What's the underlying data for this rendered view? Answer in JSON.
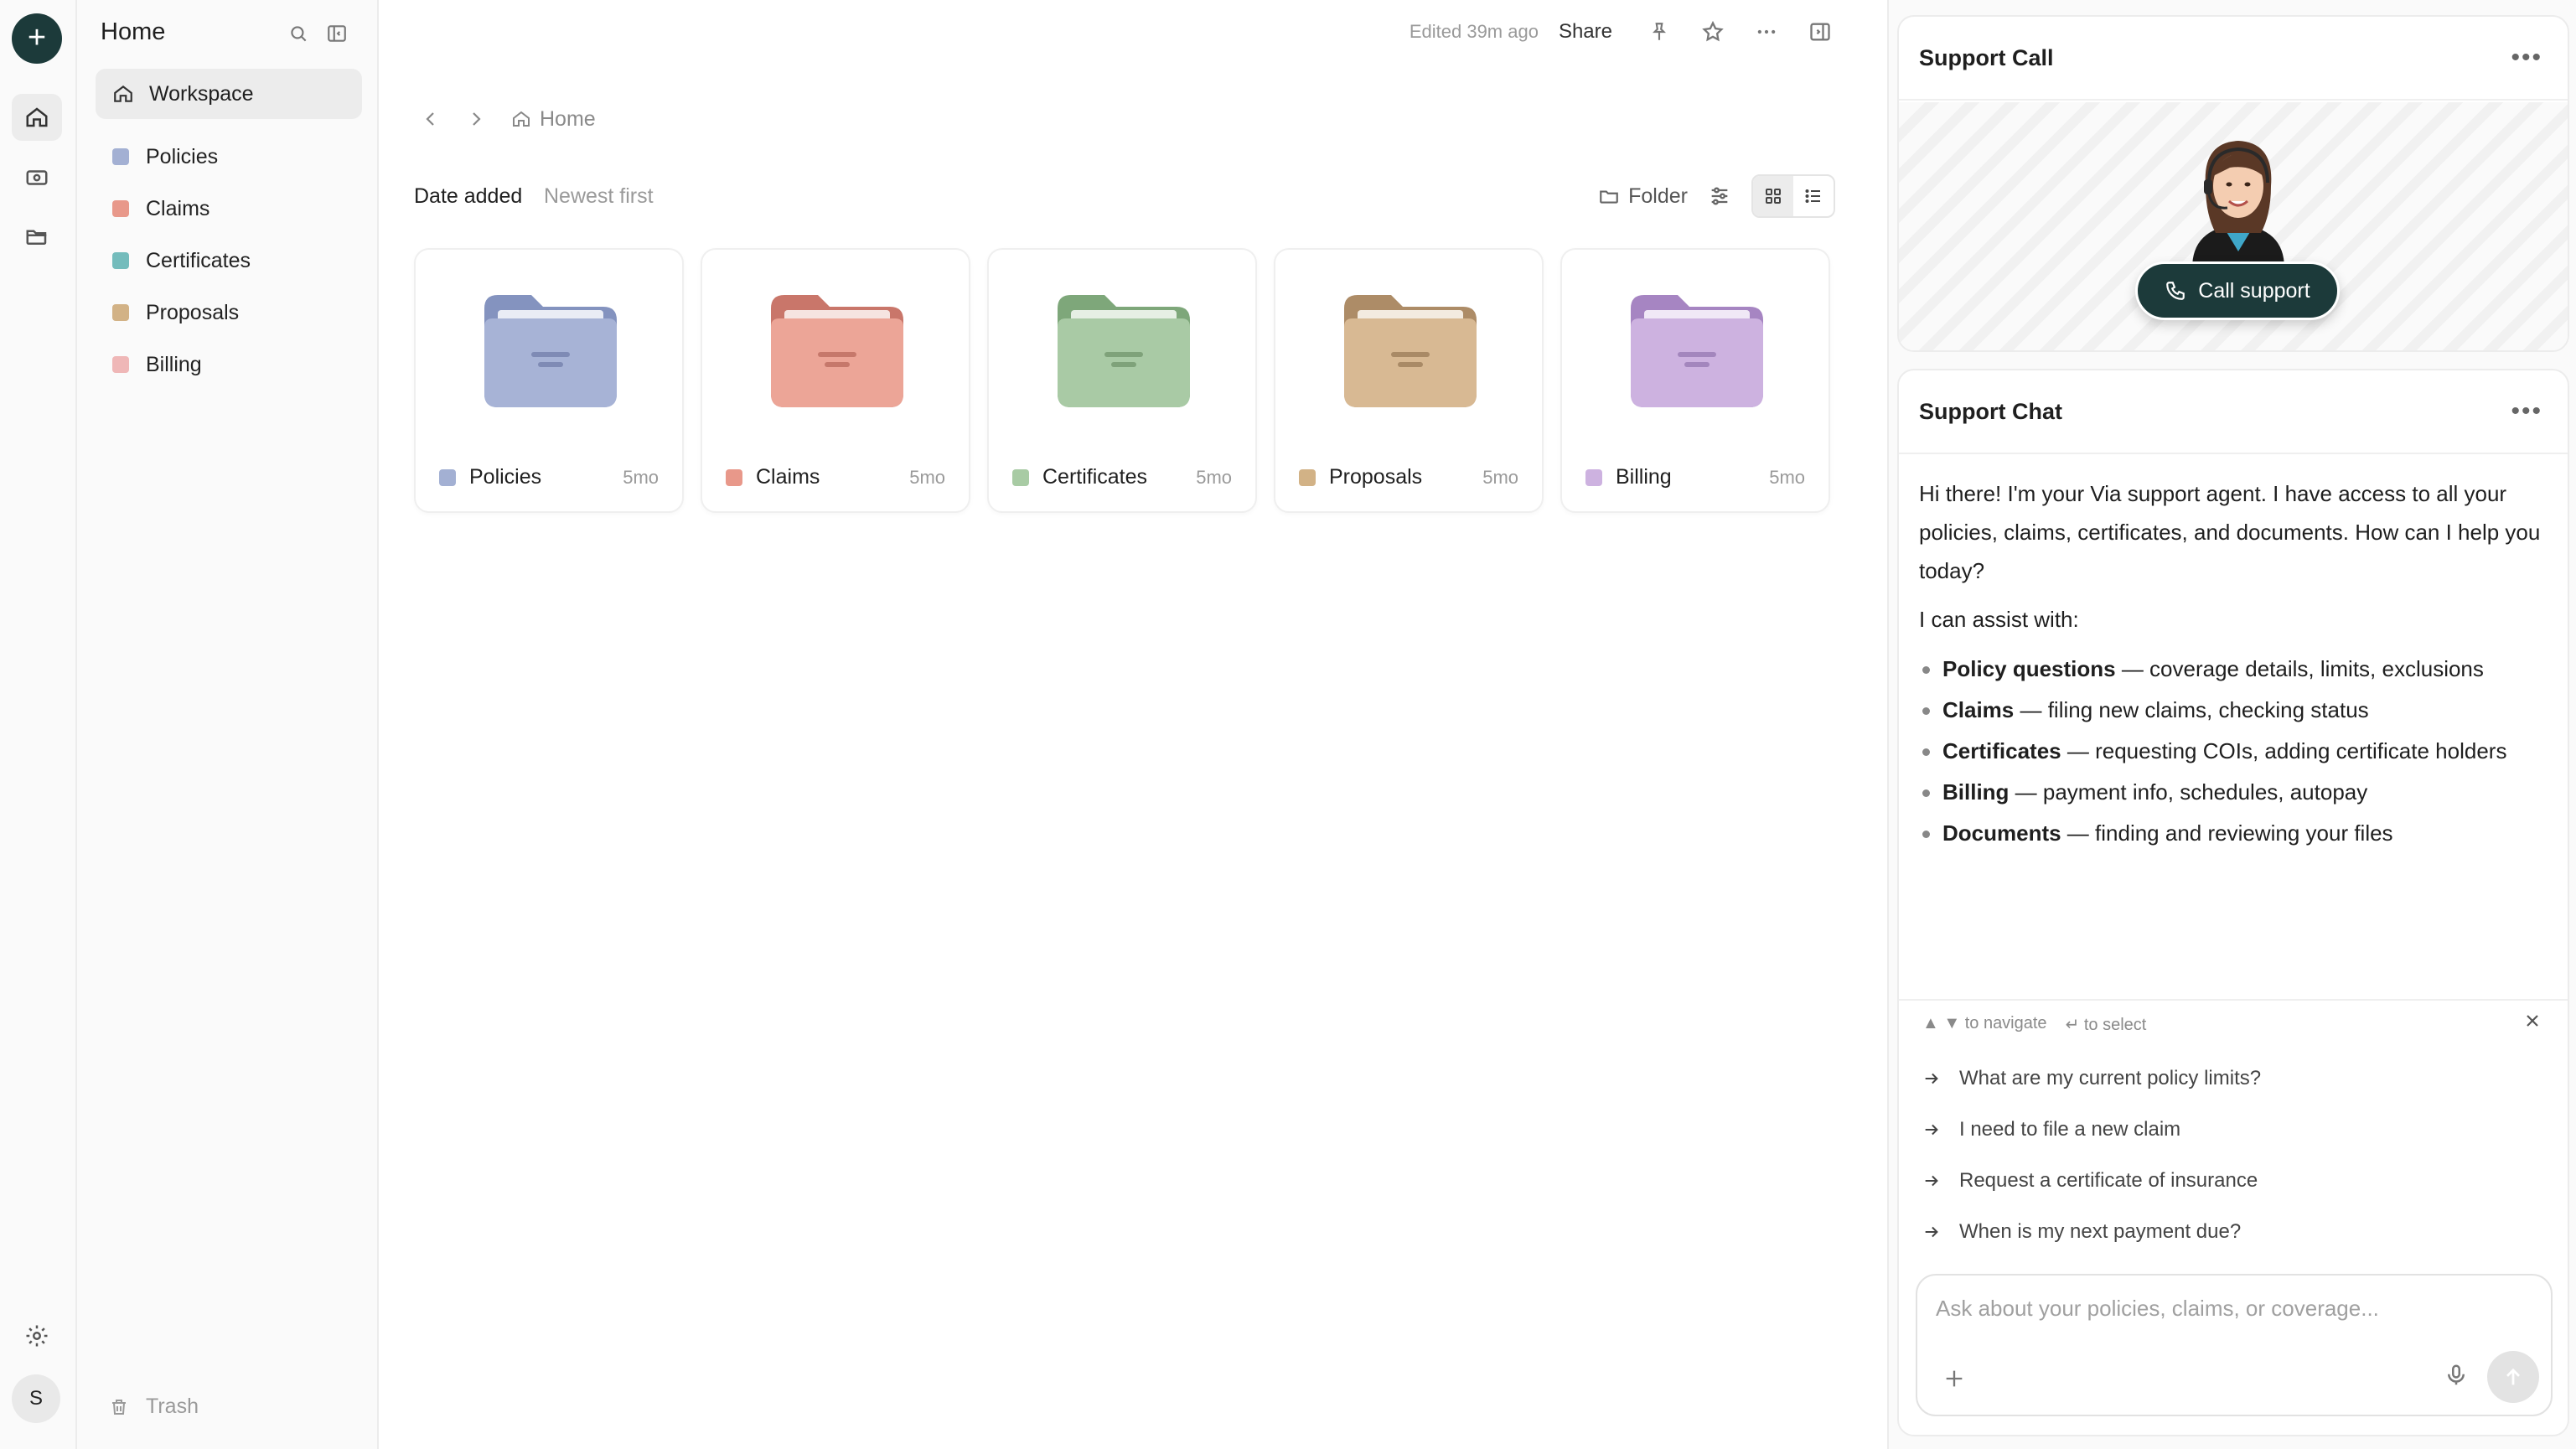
{
  "rail": {
    "new_label": "+",
    "user_initial": "S"
  },
  "sidebar": {
    "title": "Home",
    "workspace_label": "Workspace",
    "items": [
      {
        "label": "Policies",
        "color": "#a3b0d3"
      },
      {
        "label": "Claims",
        "color": "#e8988a"
      },
      {
        "label": "Certificates",
        "color": "#74bcbc"
      },
      {
        "label": "Proposals",
        "color": "#d2b286"
      },
      {
        "label": "Billing",
        "color": "#efb7b7"
      }
    ],
    "trash_label": "Trash"
  },
  "topbar": {
    "edited": "Edited 39m ago",
    "share": "Share"
  },
  "breadcrumb": {
    "home": "Home"
  },
  "toolbar": {
    "sort_label": "Date added",
    "sort_value": "Newest first",
    "folder_label": "Folder"
  },
  "folders": [
    {
      "name": "Policies",
      "age": "5mo",
      "color": "#a7b3d6",
      "dark": "#8493bf",
      "swatch": "#a3b0d3"
    },
    {
      "name": "Claims",
      "age": "5mo",
      "color": "#eca597",
      "dark": "#c9766a",
      "swatch": "#e8988a"
    },
    {
      "name": "Certificates",
      "age": "5mo",
      "color": "#a9caa5",
      "dark": "#7ea77a",
      "swatch": "#a8cba4"
    },
    {
      "name": "Proposals",
      "age": "5mo",
      "color": "#d8b993",
      "dark": "#ad8c67",
      "swatch": "#d2b286"
    },
    {
      "name": "Billing",
      "age": "5mo",
      "color": "#cdb2e0",
      "dark": "#a685c2",
      "swatch": "#cdb2e0"
    }
  ],
  "support_call": {
    "title": "Support Call",
    "button": "Call support"
  },
  "support_chat": {
    "title": "Support Chat",
    "intro": "Hi there! I'm your Via support agent. I have access to all your policies, claims, certificates, and documents. How can I help you today?",
    "assist_heading": "I can assist with:",
    "capabilities": [
      {
        "topic": "Policy questions",
        "detail": " — coverage details, limits, exclusions"
      },
      {
        "topic": "Claims",
        "detail": " — filing new claims, checking status"
      },
      {
        "topic": "Certificates",
        "detail": " — requesting COIs, adding certificate holders"
      },
      {
        "topic": "Billing",
        "detail": " — payment info, schedules, autopay"
      },
      {
        "topic": "Documents",
        "detail": " — finding and reviewing your files"
      }
    ],
    "hint_navigate": "▲ ▼ to navigate",
    "hint_select": "↵ to select",
    "suggestions": [
      "What are my current policy limits?",
      "I need to file a new claim",
      "Request a certificate of insurance",
      "When is my next payment due?"
    ],
    "input_placeholder": "Ask about your policies, claims, or coverage..."
  }
}
